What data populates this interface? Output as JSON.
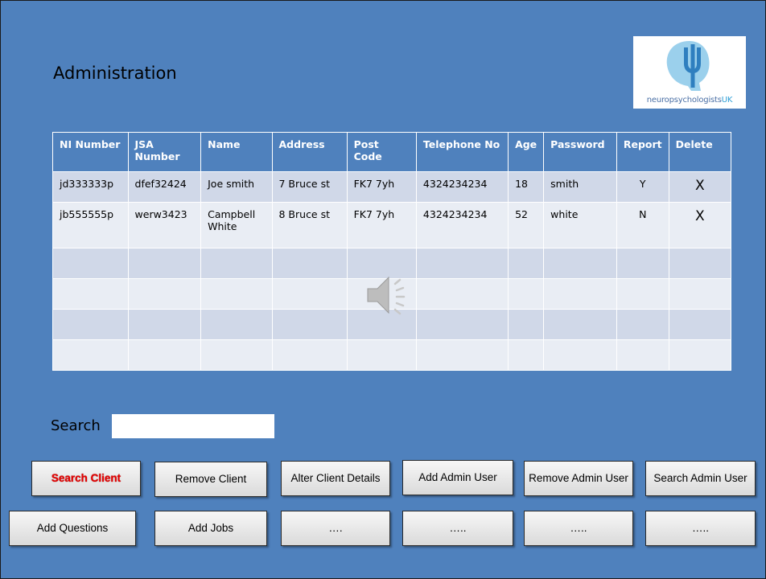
{
  "header": {
    "title": "Administration"
  },
  "logo": {
    "text_main": "neuropsychologists",
    "text_suffix": "UK"
  },
  "table": {
    "columns": [
      "NI Number",
      "JSA Number",
      "Name",
      "Address",
      "Post Code",
      "Telephone No",
      "Age",
      "Password",
      "Report",
      "Delete"
    ],
    "rows": [
      [
        "jd333333p",
        "dfef32424",
        "Joe smith",
        "7 Bruce st",
        "FK7 7yh",
        "4324234234",
        "18",
        "smith",
        "Y",
        "X"
      ],
      [
        "jb555555p",
        "werw3423",
        "Campbell White",
        "8 Bruce st",
        "FK7 7yh",
        "4324234234",
        "52",
        "white",
        "N",
        "X"
      ]
    ]
  },
  "search": {
    "label": "Search",
    "value": ""
  },
  "buttons": {
    "row1": [
      "Search Client",
      "Remove Client",
      "Alter Client Details",
      "Add Admin User",
      "Remove Admin User",
      "Search Admin User"
    ],
    "row2": [
      "Add Questions",
      "Add Jobs",
      "….",
      "…..",
      "…..",
      "….."
    ]
  },
  "colors": {
    "background": "#4f81bd",
    "row_odd": "#d0d8e8",
    "row_even": "#e9edf4",
    "delete_mark": "#e00000",
    "active_button_text": "#e60000"
  },
  "icons": {
    "logo": "psi-head-logo-icon",
    "audio": "speaker-icon"
  }
}
